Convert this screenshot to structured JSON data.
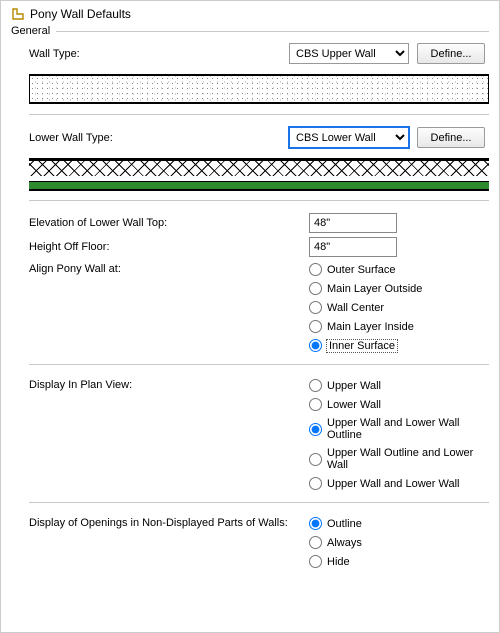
{
  "window": {
    "title": "Pony Wall Defaults"
  },
  "general": {
    "legend": "General",
    "wallType": {
      "label": "Wall Type:",
      "value": "CBS Upper Wall",
      "defineLabel": "Define..."
    },
    "lowerWallType": {
      "label": "Lower Wall Type:",
      "value": "CBS Lower Wall",
      "defineLabel": "Define..."
    },
    "elevation": {
      "label": "Elevation of Lower Wall Top:",
      "value": "48\""
    },
    "heightOffFloor": {
      "label": "Height Off Floor:",
      "value": "48\""
    },
    "align": {
      "label": "Align Pony Wall at:",
      "options": {
        "outer": "Outer Surface",
        "mainOutside": "Main Layer Outside",
        "center": "Wall Center",
        "mainInside": "Main Layer Inside",
        "inner": "Inner Surface"
      },
      "selected": "inner"
    },
    "displayPlan": {
      "label": "Display In Plan View:",
      "options": {
        "upper": "Upper Wall",
        "lower": "Lower Wall",
        "upperLowerOutline": "Upper Wall and Lower Wall Outline",
        "upperOutlineLower": "Upper Wall Outline and Lower Wall",
        "upperLower": "Upper Wall and Lower Wall"
      },
      "selected": "upperLowerOutline"
    },
    "displayOpenings": {
      "label": "Display of Openings in Non-Displayed Parts of Walls:",
      "options": {
        "outline": "Outline",
        "always": "Always",
        "hide": "Hide"
      },
      "selected": "outline"
    }
  }
}
